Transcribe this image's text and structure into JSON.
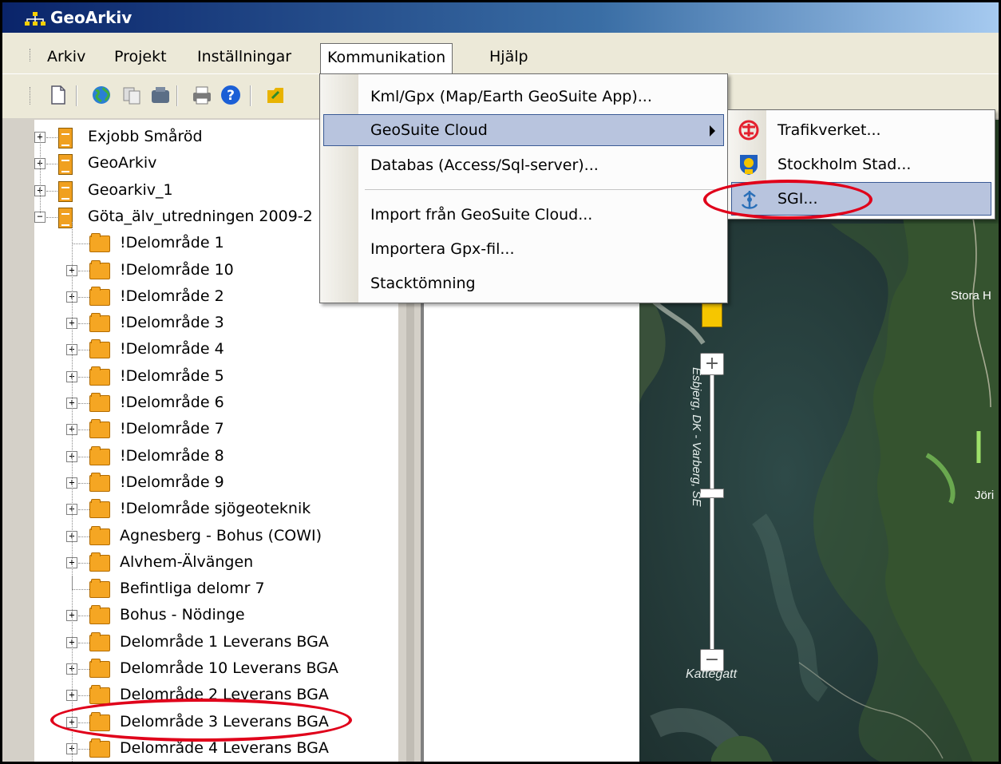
{
  "window": {
    "title": "GeoArkiv"
  },
  "menubar": {
    "items": [
      "Arkiv",
      "Projekt",
      "Inställningar",
      "Kommunikation",
      "Hjälp"
    ]
  },
  "communication_menu": {
    "items": [
      "Kml/Gpx (Map/Earth GeoSuite App)...",
      "GeoSuite Cloud",
      "Databas (Access/Sql-server)...",
      "Import från GeoSuite Cloud...",
      "Importera Gpx-fil...",
      "Stacktömning"
    ]
  },
  "cloud_submenu": {
    "items": [
      "Trafikverket...",
      "Stockholm Stad...",
      "SGI..."
    ]
  },
  "tree": {
    "rows": [
      "Exjobb Småröd",
      "GeoArkiv",
      "Geoarkiv_1",
      "Göta_älv_utredningen 2009-2",
      "!Delområde 1",
      "!Delområde 10",
      "!Delområde 2",
      "!Delområde 3",
      "!Delområde 4",
      "!Delområde 5",
      "!Delområde 6",
      "!Delområde 7",
      "!Delområde 8",
      "!Delområde 9",
      "!Delområde sjögeoteknik",
      "Agnesberg - Bohus (COWI)",
      "Alvhem-Älvängen",
      "Befintliga delomr 7",
      "Bohus - Nödinge",
      "Delområde 1 Leverans BGA",
      "Delområde 10 Leverans BGA",
      "Delområde 2 Leverans BGA",
      "Delområde 3 Leverans BGA",
      "Delområde 4 Leverans BGA"
    ]
  },
  "map": {
    "labels": [
      "Stora H",
      "Jöri",
      "Kattegatt",
      "Esbjerg, DK - Varberg, SE"
    ],
    "zoom_in": "+",
    "zoom_out": "−"
  },
  "colors": {
    "highlight": "#b8c4de",
    "annotation": "#e0001a",
    "folder": "#f5a623"
  }
}
